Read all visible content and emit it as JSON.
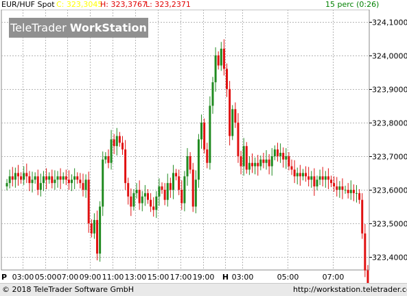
{
  "header": {
    "symbol": "EUR/HUF Spot",
    "close": "C: 323,3045",
    "high": "H: 323,3767",
    "low": "L: 323,2371",
    "interval": "15 perc (0:26)"
  },
  "watermark": {
    "brand": "TeleTrader",
    "product": "WorkStation"
  },
  "footer": {
    "copyright": "© 2018 TeleTrader Software GmbH",
    "url": "http://workstation.teletrader.com/"
  },
  "colors": {
    "up": "#1f8a1f",
    "down": "#e01010",
    "grid": "#b4b4b4",
    "current_price_bg": "#ffff00",
    "close_label": "#ffff00",
    "high_label": "#e00000",
    "low_label": "#e00000",
    "interval_label": "#008000"
  },
  "chart_data": {
    "type": "candlestick",
    "x_axis_labels": [
      "P",
      "03:00",
      "05:00",
      "07:00",
      "09:00",
      "11:00",
      "13:00",
      "15:00",
      "17:00",
      "19:00",
      "H",
      "03:00",
      "05:00",
      "07:00"
    ],
    "y_tick_labels": [
      "324,1000",
      "324,0000",
      "323,9000",
      "323,8000",
      "323,7000",
      "323,6000",
      "323,5000",
      "323,4000"
    ],
    "ylim": [
      323.345,
      324.12
    ],
    "current_price": "323,3045",
    "grid": true,
    "closes": [
      323.62,
      323.64,
      323.63,
      323.65,
      323.64,
      323.63,
      323.65,
      323.64,
      323.62,
      323.63,
      323.64,
      323.6,
      323.62,
      323.64,
      323.63,
      323.64,
      323.62,
      323.63,
      323.64,
      323.63,
      323.64,
      323.63,
      323.62,
      323.63,
      323.64,
      323.63,
      323.62,
      323.6,
      323.63,
      323.5,
      323.47,
      323.51,
      323.41,
      323.55,
      323.69,
      323.7,
      323.68,
      323.75,
      323.73,
      323.76,
      323.74,
      323.72,
      323.62,
      323.58,
      323.55,
      323.59,
      323.6,
      323.56,
      323.58,
      323.59,
      323.57,
      323.55,
      323.54,
      323.58,
      323.61,
      323.6,
      323.57,
      323.62,
      323.6,
      323.65,
      323.64,
      323.6,
      323.56,
      323.64,
      323.7,
      323.66,
      323.55,
      323.63,
      323.75,
      323.8,
      323.72,
      323.68,
      323.85,
      323.92,
      324.0,
      323.97,
      324.02,
      323.96,
      323.9,
      323.76,
      323.84,
      323.8,
      323.7,
      323.67,
      323.73,
      323.66,
      323.68,
      323.67,
      323.68,
      323.67,
      323.69,
      323.68,
      323.69,
      323.67,
      323.7,
      323.72,
      323.7,
      323.71,
      323.69,
      323.7,
      323.67,
      323.66,
      323.64,
      323.65,
      323.64,
      323.65,
      323.64,
      323.63,
      323.64,
      323.61,
      323.63,
      323.64,
      323.63,
      323.64,
      323.63,
      323.62,
      323.61,
      323.6,
      323.61,
      323.6,
      323.6,
      323.59,
      323.6,
      323.59,
      323.59,
      323.57,
      323.47,
      323.36,
      323.3
    ]
  }
}
